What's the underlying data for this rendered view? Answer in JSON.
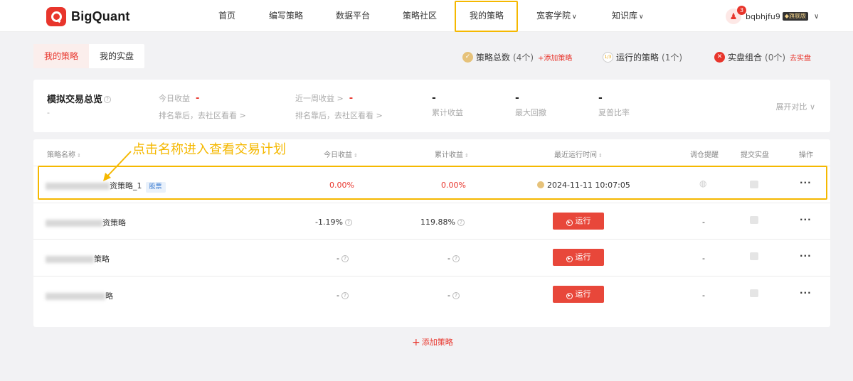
{
  "nav": {
    "brand": "BigQuant",
    "items": [
      {
        "label": "首页"
      },
      {
        "label": "编写策略"
      },
      {
        "label": "数据平台"
      },
      {
        "label": "策略社区"
      },
      {
        "label": "我的策略"
      },
      {
        "label": "宽客学院"
      },
      {
        "label": "知识库"
      }
    ],
    "user": {
      "name": "bqbhjfu9",
      "badge_count": "3",
      "tier": "旗舰版"
    }
  },
  "tabs": [
    {
      "label": "我的策略",
      "active": true
    },
    {
      "label": "我的实盘",
      "active": false
    }
  ],
  "stats": {
    "total": {
      "label": "策略总数",
      "count": "(4个)",
      "link": "+添加策略"
    },
    "running": {
      "label": "运行的策略",
      "count": "(1个)",
      "icon_text": "1/3"
    },
    "live": {
      "label": "实盘组合",
      "count": "(0个)",
      "link": "去实盘"
    }
  },
  "overview": {
    "title": "模拟交易总览",
    "title_help": "?",
    "subtitle": "-",
    "metrics": [
      {
        "label": "今日收益",
        "value": "-",
        "sub": "排名靠后，去社区看看 >"
      },
      {
        "label": "近一周收益 >",
        "value": "-",
        "sub": "排名靠后，去社区看看 >"
      },
      {
        "label": "累计收益",
        "value": "-"
      },
      {
        "label": "最大回撤",
        "value": "-"
      },
      {
        "label": "夏普比率",
        "value": "-"
      }
    ],
    "expand": "展开对比"
  },
  "table": {
    "headers": {
      "name": "策略名称",
      "today": "今日收益",
      "cumulative": "累计收益",
      "last_run": "最近运行时间",
      "rebalance": "调仓提醒",
      "submit": "提交实盘",
      "ops": "操作"
    },
    "rows": [
      {
        "name_suffix": "资策略_1",
        "tag": "股票",
        "today": "0.00%",
        "cumulative": "0.00%",
        "last_run": "2024-11-11 10:07:05",
        "rebalance_icon": "wechat-icon",
        "submit_icon": "chart-icon",
        "ops": "···"
      },
      {
        "name_suffix": "资策略",
        "today": "-1.19%",
        "cumulative": "119.88%",
        "run_label": "运行",
        "rebalance": "-",
        "submit_icon": "chart-icon",
        "ops": "···"
      },
      {
        "name_suffix": "策略",
        "today": "-",
        "cumulative": "-",
        "run_label": "运行",
        "rebalance": "-",
        "submit_icon": "chart-icon",
        "ops": "···"
      },
      {
        "name_suffix": "略",
        "today": "-",
        "cumulative": "-",
        "run_label": "运行",
        "rebalance": "-",
        "submit_icon": "chart-icon",
        "ops": "···"
      }
    ]
  },
  "annotation": "点击名称进入查看交易计划",
  "add_strategy": "添加策略",
  "colors": {
    "accent": "#e8352c",
    "highlight": "#f5b800",
    "run_button": "#e8473a"
  }
}
